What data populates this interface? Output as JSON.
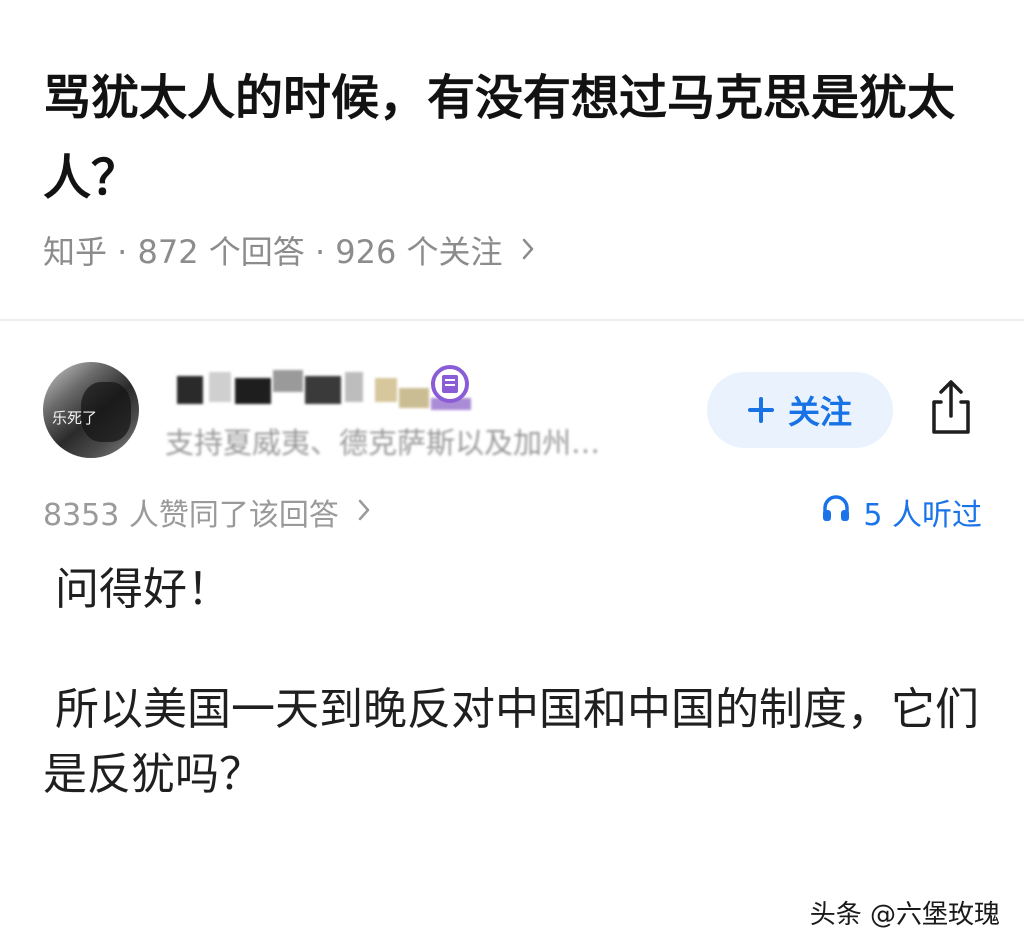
{
  "question": {
    "title": "骂犹太人的时候，有没有想过马克思是犹太人？",
    "meta": "知乎 · 872 个回答 · 926 个关注"
  },
  "author": {
    "avatar_caption": "乐死了",
    "bio": "支持夏威夷、德克萨斯以及加州…",
    "follow_label": "关注",
    "follow_icon": "plus-icon",
    "share_icon": "share-icon",
    "badge_icon": "creator-badge-icon"
  },
  "answer": {
    "upvotes": "8353 人赞同了该回答",
    "listened": "5 人听过",
    "listened_icon": "headphones-icon",
    "paragraphs": [
      "问得好！",
      "所以美国一天到晚反对中国和中国的制度，它们是反犹吗？"
    ]
  },
  "watermark": "头条 @六堡玫瑰",
  "colors": {
    "accent": "#1772e6",
    "follow_bg": "#e9f2fd",
    "muted_text": "#8c8c8c",
    "body_text": "#1f1f1f"
  }
}
